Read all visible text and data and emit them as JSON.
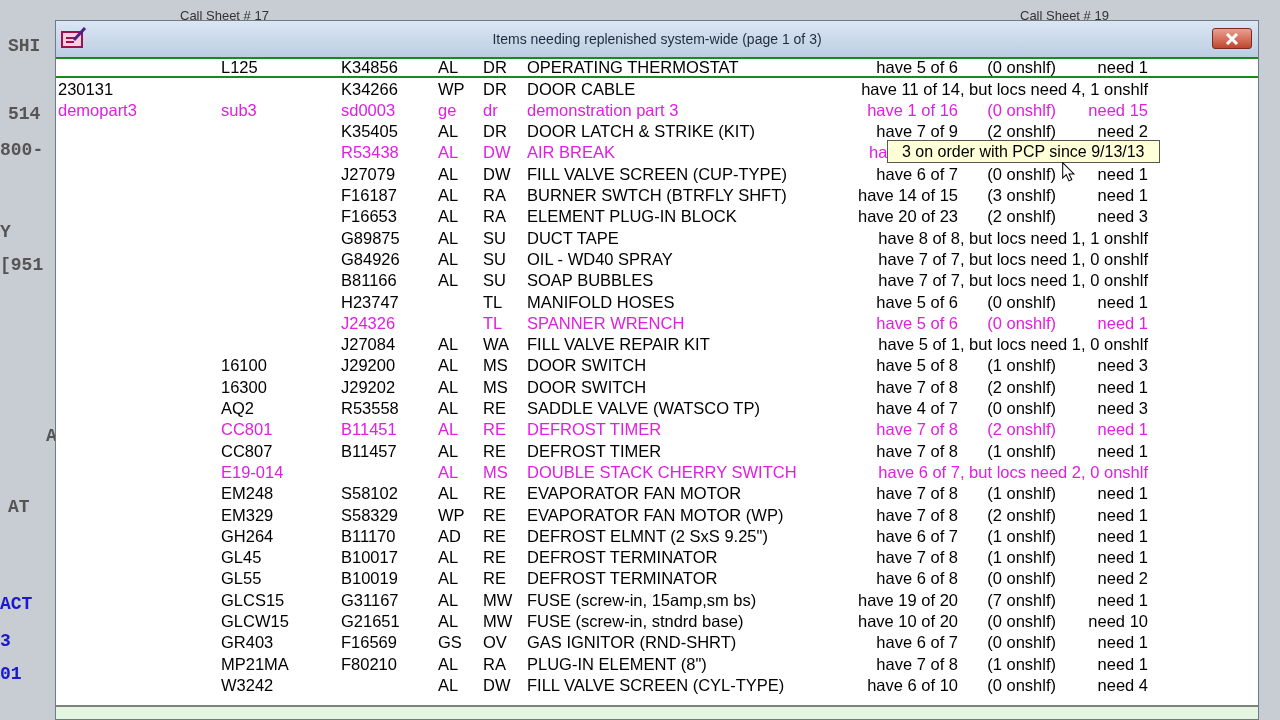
{
  "background_window": {
    "headers": [
      "Call Sheet #  17",
      "Call Sheet #  19"
    ],
    "left_fragments": [
      {
        "text": "SHI",
        "kind": "gray"
      },
      {
        "text": "514",
        "kind": "gray"
      },
      {
        "text": "800-",
        "kind": "gray"
      },
      {
        "text": "Y",
        "kind": "gray"
      },
      {
        "text": "[951",
        "kind": "gray"
      },
      {
        "text": "A",
        "kind": "gray"
      },
      {
        "text": "AT",
        "kind": "gray"
      },
      {
        "text": "ACT",
        "kind": "blue"
      },
      {
        "text": "3",
        "kind": "blue"
      },
      {
        "text": "01",
        "kind": "blue"
      }
    ]
  },
  "window": {
    "title": "Items needing replenished system-wide (page 1 of 3)"
  },
  "rows": [
    {
      "c1": "",
      "c2": "L125",
      "part": "K34856",
      "mfr": "AL",
      "cat": "DR",
      "desc": "OPERATING THERMOSTAT",
      "status": {
        "have": "have 5 of 6",
        "onshlf": "(0 onshlf)",
        "need": "need 1"
      },
      "highlight": false,
      "selected": true
    },
    {
      "c1": "230131",
      "c2": "",
      "part": "K34266",
      "mfr": "WP",
      "cat": "DR",
      "desc": "DOOR CABLE",
      "status": {
        "note": "have 11 of 14, but locs need 4, 1 onshlf"
      },
      "highlight": false,
      "selected": false
    },
    {
      "c1": "demopart3",
      "c2": "sub3",
      "part": "sd0003",
      "mfr": "ge",
      "cat": "dr",
      "desc": "demonstration part 3",
      "status": {
        "have": "have 1 of 16",
        "onshlf": "(0 onshlf)",
        "need": "need 15"
      },
      "highlight": true,
      "selected": false
    },
    {
      "c1": "",
      "c2": "",
      "part": "K35405",
      "mfr": "AL",
      "cat": "DR",
      "desc": "DOOR LATCH & STRIKE (KIT)",
      "status": {
        "have": "have 7 of 9",
        "onshlf": "(2 onshlf)",
        "need": "need 2"
      },
      "highlight": false,
      "selected": false
    },
    {
      "c1": "",
      "c2": "",
      "part": "R53438",
      "mfr": "AL",
      "cat": "DW",
      "desc": "AIR BREAK",
      "status": {
        "have": "ha"
      },
      "highlight": true,
      "selected": false
    },
    {
      "c1": "",
      "c2": "",
      "part": "J27079",
      "mfr": "AL",
      "cat": "DW",
      "desc": "FILL VALVE SCREEN (CUP-TYPE)",
      "status": {
        "have": "have 6 of 7",
        "onshlf": "(0 onshlf)",
        "need": "need 1"
      },
      "highlight": false,
      "selected": false
    },
    {
      "c1": "",
      "c2": "",
      "part": "F16187",
      "mfr": "AL",
      "cat": "RA",
      "desc": "BURNER SWTCH (BTRFLY SHFT)",
      "status": {
        "have": "have 14 of 15",
        "onshlf": "(3 onshlf)",
        "need": "need 1"
      },
      "highlight": false,
      "selected": false
    },
    {
      "c1": "",
      "c2": "",
      "part": "F16653",
      "mfr": "AL",
      "cat": "RA",
      "desc": "ELEMENT PLUG-IN BLOCK",
      "status": {
        "have": "have 20 of 23",
        "onshlf": "(2 onshlf)",
        "need": "need 3"
      },
      "highlight": false,
      "selected": false
    },
    {
      "c1": "",
      "c2": "",
      "part": "G89875",
      "mfr": "AL",
      "cat": "SU",
      "desc": "DUCT TAPE",
      "status": {
        "note": "have 8 of 8, but locs need 1, 1 onshlf"
      },
      "highlight": false,
      "selected": false
    },
    {
      "c1": "",
      "c2": "",
      "part": "G84926",
      "mfr": "AL",
      "cat": "SU",
      "desc": "OIL - WD40 SPRAY",
      "status": {
        "note": "have 7 of 7, but locs need 1, 0 onshlf"
      },
      "highlight": false,
      "selected": false
    },
    {
      "c1": "",
      "c2": "",
      "part": "B81166",
      "mfr": "AL",
      "cat": "SU",
      "desc": "SOAP BUBBLES",
      "status": {
        "note": "have 7 of 7, but locs need 1, 0 onshlf"
      },
      "highlight": false,
      "selected": false
    },
    {
      "c1": "",
      "c2": "",
      "part": "H23747",
      "mfr": "",
      "cat": "TL",
      "desc": "MANIFOLD HOSES",
      "status": {
        "have": "have 5 of 6",
        "onshlf": "(0 onshlf)",
        "need": "need 1"
      },
      "highlight": false,
      "selected": false
    },
    {
      "c1": "",
      "c2": "",
      "part": "J24326",
      "mfr": "",
      "cat": "TL",
      "desc": "SPANNER WRENCH",
      "status": {
        "have": "have 5 of 6",
        "onshlf": "(0 onshlf)",
        "need": "need 1"
      },
      "highlight": true,
      "selected": false
    },
    {
      "c1": "",
      "c2": "",
      "part": "J27084",
      "mfr": "AL",
      "cat": "WA",
      "desc": "FILL VALVE REPAIR KIT",
      "status": {
        "note": "have 5 of 1, but locs need 1, 0 onshlf"
      },
      "highlight": false,
      "selected": false
    },
    {
      "c1": "",
      "c2": "16100",
      "part": "J29200",
      "mfr": "AL",
      "cat": "MS",
      "desc": "DOOR SWITCH",
      "status": {
        "have": "have 5 of 8",
        "onshlf": "(1 onshlf)",
        "need": "need 3"
      },
      "highlight": false,
      "selected": false
    },
    {
      "c1": "",
      "c2": "16300",
      "part": "J29202",
      "mfr": "AL",
      "cat": "MS",
      "desc": "DOOR SWITCH",
      "status": {
        "have": "have 7 of 8",
        "onshlf": "(2 onshlf)",
        "need": "need 1"
      },
      "highlight": false,
      "selected": false
    },
    {
      "c1": "",
      "c2": "AQ2",
      "part": "R53558",
      "mfr": "AL",
      "cat": "RE",
      "desc": "SADDLE VALVE (WATSCO TP)",
      "status": {
        "have": "have 4 of 7",
        "onshlf": "(0 onshlf)",
        "need": "need 3"
      },
      "highlight": false,
      "selected": false
    },
    {
      "c1": "",
      "c2": "CC801",
      "part": "B11451",
      "mfr": "AL",
      "cat": "RE",
      "desc": "DEFROST TIMER",
      "status": {
        "have": "have 7 of 8",
        "onshlf": "(2 onshlf)",
        "need": "need 1"
      },
      "highlight": true,
      "selected": false
    },
    {
      "c1": "",
      "c2": "CC807",
      "part": "B11457",
      "mfr": "AL",
      "cat": "RE",
      "desc": "DEFROST TIMER",
      "status": {
        "have": "have 7 of 8",
        "onshlf": "(1 onshlf)",
        "need": "need 1"
      },
      "highlight": false,
      "selected": false
    },
    {
      "c1": "",
      "c2": "E19-014",
      "part": "",
      "mfr": "AL",
      "cat": "MS",
      "desc": "DOUBLE STACK CHERRY SWITCH",
      "status": {
        "note": "have 6 of 7, but locs need 2, 0 onshlf"
      },
      "highlight": true,
      "selected": false
    },
    {
      "c1": "",
      "c2": "EM248",
      "part": "S58102",
      "mfr": "AL",
      "cat": "RE",
      "desc": "EVAPORATOR FAN MOTOR",
      "status": {
        "have": "have 7 of 8",
        "onshlf": "(1 onshlf)",
        "need": "need 1"
      },
      "highlight": false,
      "selected": false
    },
    {
      "c1": "",
      "c2": "EM329",
      "part": "S58329",
      "mfr": "WP",
      "cat": "RE",
      "desc": "EVAPORATOR FAN MOTOR (WP)",
      "status": {
        "have": "have 7 of 8",
        "onshlf": "(2 onshlf)",
        "need": "need 1"
      },
      "highlight": false,
      "selected": false
    },
    {
      "c1": "",
      "c2": "GH264",
      "part": "B11170",
      "mfr": "AD",
      "cat": "RE",
      "desc": "DEFROST ELMNT (2 SxS 9.25\")",
      "status": {
        "have": "have 6 of 7",
        "onshlf": "(1 onshlf)",
        "need": "need 1"
      },
      "highlight": false,
      "selected": false
    },
    {
      "c1": "",
      "c2": "GL45",
      "part": "B10017",
      "mfr": "AL",
      "cat": "RE",
      "desc": "DEFROST TERMINATOR",
      "status": {
        "have": "have 7 of 8",
        "onshlf": "(1 onshlf)",
        "need": "need 1"
      },
      "highlight": false,
      "selected": false
    },
    {
      "c1": "",
      "c2": "GL55",
      "part": "B10019",
      "mfr": "AL",
      "cat": "RE",
      "desc": "DEFROST TERMINATOR",
      "status": {
        "have": "have 6 of 8",
        "onshlf": "(0 onshlf)",
        "need": "need 2"
      },
      "highlight": false,
      "selected": false
    },
    {
      "c1": "",
      "c2": "GLCS15",
      "part": "G31167",
      "mfr": "AL",
      "cat": "MW",
      "desc": "FUSE (screw-in, 15amp,sm bs)",
      "status": {
        "have": "have 19 of 20",
        "onshlf": "(7 onshlf)",
        "need": "need 1"
      },
      "highlight": false,
      "selected": false
    },
    {
      "c1": "",
      "c2": "GLCW15",
      "part": "G21651",
      "mfr": "AL",
      "cat": "MW",
      "desc": "FUSE (screw-in, stndrd base)",
      "status": {
        "have": "have 10 of 20",
        "onshlf": "(0 onshlf)",
        "need": "need 10"
      },
      "highlight": false,
      "selected": false
    },
    {
      "c1": "",
      "c2": "GR403",
      "part": "F16569",
      "mfr": "GS",
      "cat": "OV",
      "desc": "GAS IGNITOR (RND-SHRT)",
      "status": {
        "have": "have 6 of 7",
        "onshlf": "(0 onshlf)",
        "need": "need 1"
      },
      "highlight": false,
      "selected": false
    },
    {
      "c1": "",
      "c2": "MP21MA",
      "part": "F80210",
      "mfr": "AL",
      "cat": "RA",
      "desc": "PLUG-IN ELEMENT (8\")",
      "status": {
        "have": "have 7 of 8",
        "onshlf": "(1 onshlf)",
        "need": "need 1"
      },
      "highlight": false,
      "selected": false
    },
    {
      "c1": "",
      "c2": "W3242",
      "part": "",
      "mfr": "AL",
      "cat": "DW",
      "desc": "FILL VALVE SCREEN (CYL-TYPE)",
      "status": {
        "have": "have 6 of 10",
        "onshlf": "(0 onshlf)",
        "need": "need 4"
      },
      "highlight": false,
      "selected": false
    }
  ],
  "tooltip": {
    "text": "3 on order with PCP since 9/13/13"
  }
}
